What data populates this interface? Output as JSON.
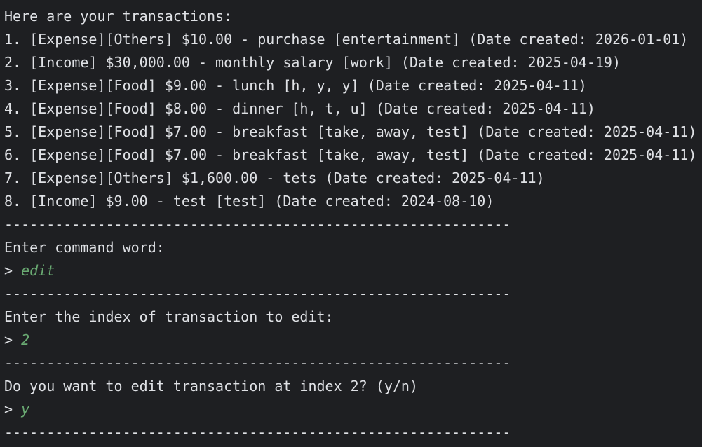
{
  "terminal": {
    "header": "Here are your transactions:",
    "transactions": [
      "1. [Expense][Others] $10.00 - purchase [entertainment] (Date created: 2026-01-01)",
      "2. [Income] $30,000.00 - monthly salary [work] (Date created: 2025-04-19)",
      "3. [Expense][Food] $9.00 - lunch [h, y, y] (Date created: 2025-04-11)",
      "4. [Expense][Food] $8.00 - dinner [h, t, u] (Date created: 2025-04-11)",
      "5. [Expense][Food] $7.00 - breakfast [take, away, test] (Date created: 2025-04-11)",
      "6. [Expense][Food] $7.00 - breakfast [take, away, test] (Date created: 2025-04-11)",
      "7. [Expense][Others] $1,600.00 - tets (Date created: 2025-04-11)",
      "8. [Income] $9.00 - test [test] (Date created: 2024-08-10)"
    ],
    "separator": "------------------------------------------------------------",
    "prompt_symbol": "> ",
    "steps": [
      {
        "question": "Enter command word:",
        "answer": "edit"
      },
      {
        "question": "Enter the index of transaction to edit:",
        "answer": "2"
      },
      {
        "question": "Do you want to edit transaction at index 2? (y/n)",
        "answer": "y"
      }
    ]
  }
}
